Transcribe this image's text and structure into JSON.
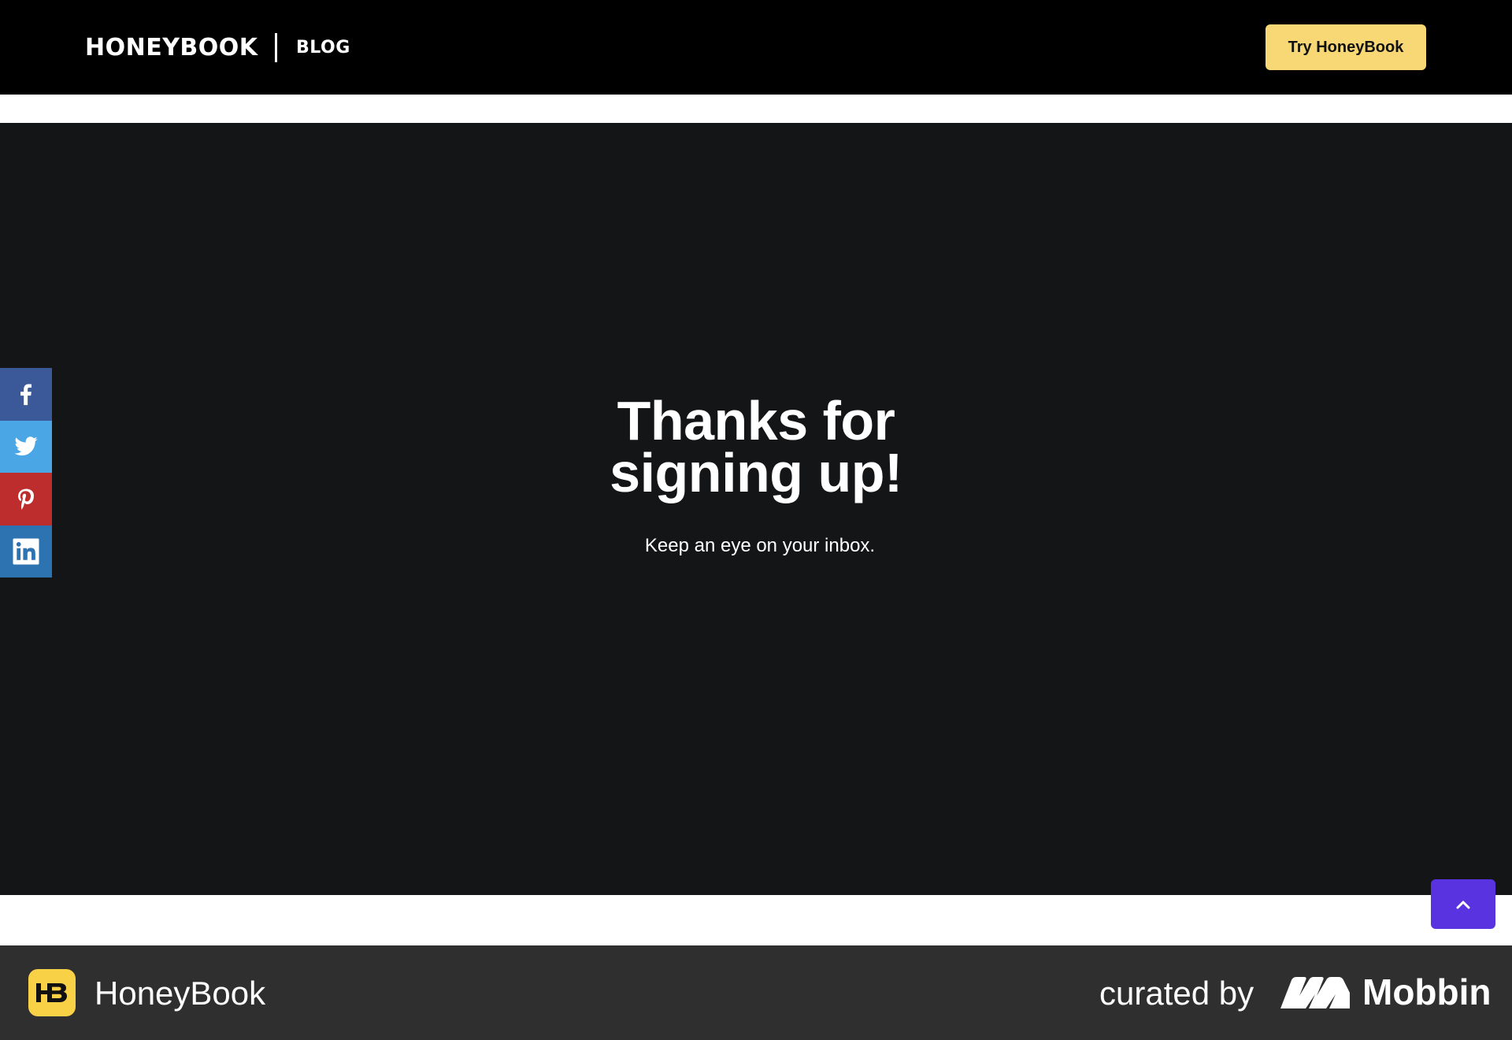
{
  "header": {
    "logo_text": "HONEYBOOK",
    "blog_label": "BLOG",
    "cta_label": "Try HoneyBook",
    "cta_color": "#f8d775"
  },
  "hero": {
    "title_line1": "Thanks for",
    "title_line2": "signing up!",
    "subtitle": "Keep an eye on your inbox."
  },
  "share": {
    "items": [
      {
        "network": "Facebook",
        "icon": "facebook-icon",
        "color": "#3b5998"
      },
      {
        "network": "Twitter",
        "icon": "twitter-icon",
        "color": "#4ba6e6"
      },
      {
        "network": "Pinterest",
        "icon": "pinterest-icon",
        "color": "#be2d2d"
      },
      {
        "network": "LinkedIn",
        "icon": "linkedin-icon",
        "color": "#2d72b1"
      }
    ]
  },
  "back_to_top": {
    "icon": "chevron-up-icon",
    "color": "#5a33e0"
  },
  "footer": {
    "app_icon_text": "HB",
    "app_name": "HoneyBook",
    "curated_by": "curated by",
    "brand": "Mobbin"
  }
}
